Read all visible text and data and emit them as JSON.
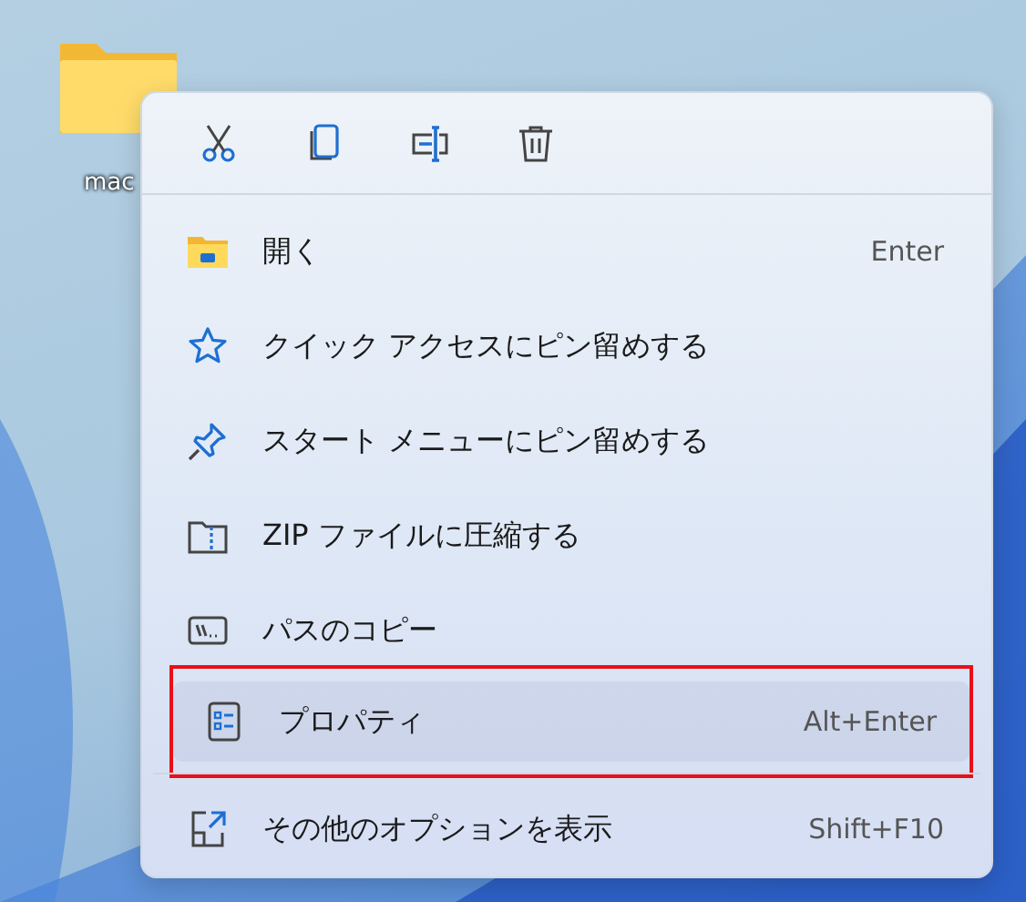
{
  "desktop": {
    "folder_label": "mac"
  },
  "menu": {
    "items": [
      {
        "kind": "open",
        "label": "開く",
        "shortcut": "Enter",
        "selected": false,
        "highlighted": false,
        "separated": false
      },
      {
        "kind": "star",
        "label": "クイック アクセスにピン留めする",
        "selected": false,
        "highlighted": false,
        "separated": false
      },
      {
        "kind": "pin",
        "label": "スタート メニューにピン留めする",
        "selected": false,
        "highlighted": false,
        "separated": false
      },
      {
        "kind": "zip",
        "label": "ZIP ファイルに圧縮する",
        "selected": false,
        "highlighted": false,
        "separated": false
      },
      {
        "kind": "path",
        "label": "パスのコピー",
        "selected": false,
        "highlighted": false,
        "separated": false
      },
      {
        "kind": "properties",
        "label": "プロパティ",
        "shortcut": "Alt+Enter",
        "selected": true,
        "highlighted": true,
        "separated": false
      },
      {
        "kind": "more",
        "label": "その他のオプションを表示",
        "shortcut": "Shift+F10",
        "selected": false,
        "highlighted": false,
        "separated": true
      }
    ]
  }
}
